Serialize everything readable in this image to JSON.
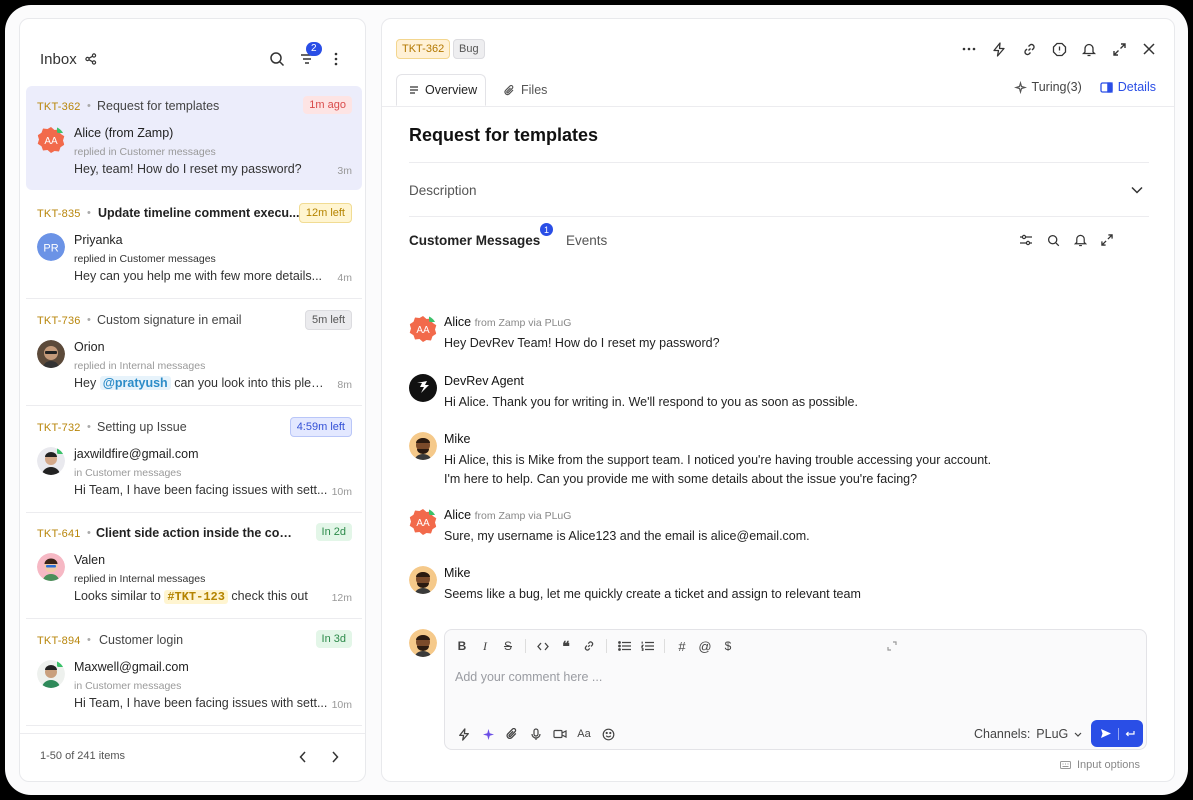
{
  "inbox": {
    "title": "Inbox",
    "filter_badge": "2",
    "pagination": "1-50 of 241 items",
    "tickets": [
      {
        "id": "TKT-362",
        "title": "Request for templates",
        "bold": false,
        "pill": "1m ago",
        "pill_style": "red",
        "name": "Alice (from Zamp)",
        "sub": "replied in Customer messages",
        "msg": "Hey, team! How do I reset my password?",
        "time": "3m"
      },
      {
        "id": "TKT-835",
        "title": "Update timeline comment execu...",
        "bold": true,
        "pill": "12m left",
        "pill_style": "yellow",
        "name": "Priyanka",
        "sub": "replied in Customer messages",
        "msg": "Hey can you help me with few more details...",
        "time": "4m"
      },
      {
        "id": "TKT-736",
        "title": "Custom signature in email",
        "bold": false,
        "pill": "5m left",
        "pill_style": "gray",
        "name": "Orion",
        "sub": "replied in Internal messages",
        "msg_prefix": "Hey",
        "mention": "@pratyush",
        "msg_suffix": "can you look into this please",
        "time": "8m"
      },
      {
        "id": "TKT-732",
        "title": "Setting up Issue",
        "bold": false,
        "pill": "4:59m left",
        "pill_style": "blue",
        "name": "jaxwildfire@gmail.com",
        "sub": "in Customer messages",
        "msg": "Hi Team, I have been facing issues with sett...",
        "time": "10m"
      },
      {
        "id": "TKT-641",
        "title": "Client side action inside the comme...",
        "bold": true,
        "pill": "In 2d",
        "pill_style": "green",
        "name": "Valen",
        "sub": "replied in Internal messages",
        "msg_prefix": "Looks similar to",
        "tag": "#TKT-123",
        "msg_suffix": "check this out",
        "time": "12m"
      },
      {
        "id": "TKT-894",
        "title": "Customer login",
        "bold": false,
        "pill": "In 3d",
        "pill_style": "green",
        "name": "Maxwell@gmail.com",
        "sub": "in Customer messages",
        "msg": "Hi Team, I have been facing issues with sett...",
        "time": "10m"
      }
    ]
  },
  "detail": {
    "ticket_id": "TKT-362",
    "type_tag": "Bug",
    "tabs": [
      "Overview",
      "Files"
    ],
    "turing": "Turing(3)",
    "details": "Details",
    "subject": "Request for templates",
    "description_label": "Description",
    "messages_tab": "Customer Messages",
    "messages_badge": "1",
    "events_tab": "Events",
    "messages": [
      {
        "author": "Alice",
        "via": "from Zamp via PLuG",
        "text": "Hey DevRev Team! How do I reset my password?",
        "avatar": "alice"
      },
      {
        "author": "DevRev Agent",
        "via": "",
        "text": "Hi Alice. Thank you for writing in. We'll respond to you as soon as possible.",
        "avatar": "devrev"
      },
      {
        "author": "Mike",
        "via": "",
        "text": "Hi Alice, this is Mike from the support team. I noticed you're having trouble accessing your account.\nI'm here to help. Can you provide me with some details about the issue you're facing?",
        "avatar": "mike"
      },
      {
        "author": "Alice",
        "via": "from Zamp via PLuG",
        "text": "Sure, my username is Alice123 and the email is alice@email.com.",
        "avatar": "alice"
      },
      {
        "author": "Mike",
        "via": "",
        "text": "Seems like a bug, let me quickly create a ticket and assign to relevant team",
        "avatar": "mike"
      }
    ],
    "composer": {
      "placeholder": "Add your comment here ...",
      "channels_label": "Channels:",
      "channel": "PLuG",
      "input_options": "Input options"
    }
  },
  "colors": {
    "accent": "#2a4ee6",
    "ticket_id": "#b8860b",
    "selected_bg": "#ecedfb"
  }
}
